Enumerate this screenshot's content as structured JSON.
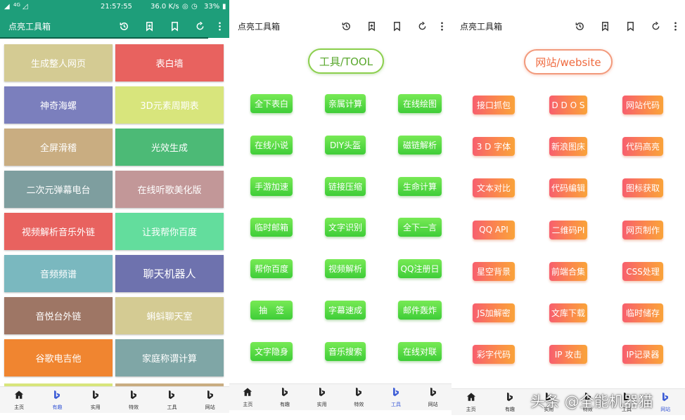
{
  "status_bar": {
    "signal": "4G",
    "time": "21:57:55",
    "speed": "36.0 K/s",
    "battery": "33%"
  },
  "panels": [
    {
      "title": "点亮工具箱",
      "tiles": [
        {
          "label": "生成整人网页",
          "color": "#d4cb93"
        },
        {
          "label": "表白墙",
          "color": "#e8625f"
        },
        {
          "label": "神奇海螺",
          "color": "#7b7fbd"
        },
        {
          "label": "3D元素周期表",
          "color": "#d8e57c"
        },
        {
          "label": "全屏滑稽",
          "color": "#c9ad81"
        },
        {
          "label": "光效生成",
          "color": "#4cba76"
        },
        {
          "label": "二次元弹幕电台",
          "color": "#7e9e9f"
        },
        {
          "label": "在线听歌美化版",
          "color": "#c29798"
        },
        {
          "label": "视频解析音乐外链",
          "color": "#e8625f"
        },
        {
          "label": "让我帮你百度",
          "color": "#63dd9d"
        },
        {
          "label": "音频频谱",
          "color": "#7ab8bf"
        },
        {
          "label": "聊天机器人",
          "color": "#6e72ae"
        },
        {
          "label": "音悦台外链",
          "color": "#9e7665"
        },
        {
          "label": "蝌蚪聊天室",
          "color": "#d4cb93"
        },
        {
          "label": "谷歌电吉他",
          "color": "#f08530"
        },
        {
          "label": "家庭称谓计算",
          "color": "#7fa6a6"
        }
      ],
      "tail_colors": [
        "#d8e57c",
        "#c9ad81"
      ],
      "active_tab": 1
    },
    {
      "title": "点亮工具箱",
      "section_label": "工具/TOOL",
      "buttons": [
        [
          "全下表白",
          "亲属计算",
          "在线绘图"
        ],
        [
          "在线小说",
          "DIY头盔",
          "磁链解析"
        ],
        [
          "手游加速",
          "链接压缩",
          "生命计算"
        ],
        [
          "临时邮箱",
          "文字识别",
          "全下一言"
        ],
        [
          "帮你百度",
          "视频解析",
          "QQ注册日"
        ],
        [
          "抽　签",
          "字幕速成",
          "邮件轰炸"
        ],
        [
          "文字隐身",
          "音乐搜索",
          "在线对联"
        ]
      ],
      "active_tab": 4
    },
    {
      "title": "点亮工具箱",
      "section_label": "网站/website",
      "buttons": [
        [
          "接口抓包",
          "D D O S",
          "网站代码"
        ],
        [
          "3 D 字体",
          "新浪图床",
          "代码高亮"
        ],
        [
          "文本对比",
          "代码编辑",
          "图标获取"
        ],
        [
          "QQ API",
          "二维码PI",
          "网页制作"
        ],
        [
          "星空背景",
          "前端合集",
          "CSS处理"
        ],
        [
          "JS加解密",
          "文库下载",
          "临时储存"
        ],
        [
          "彩字代码",
          "IP 攻击",
          "IP记录器"
        ]
      ],
      "active_tab": 5
    }
  ],
  "nav_tabs": [
    "主页",
    "有趣",
    "实用",
    "特效",
    "工具",
    "网站"
  ],
  "watermark": "头条 @全能机器猫",
  "accent_color": "#1e9e7a",
  "active_tab_color": "#3b5bd6"
}
